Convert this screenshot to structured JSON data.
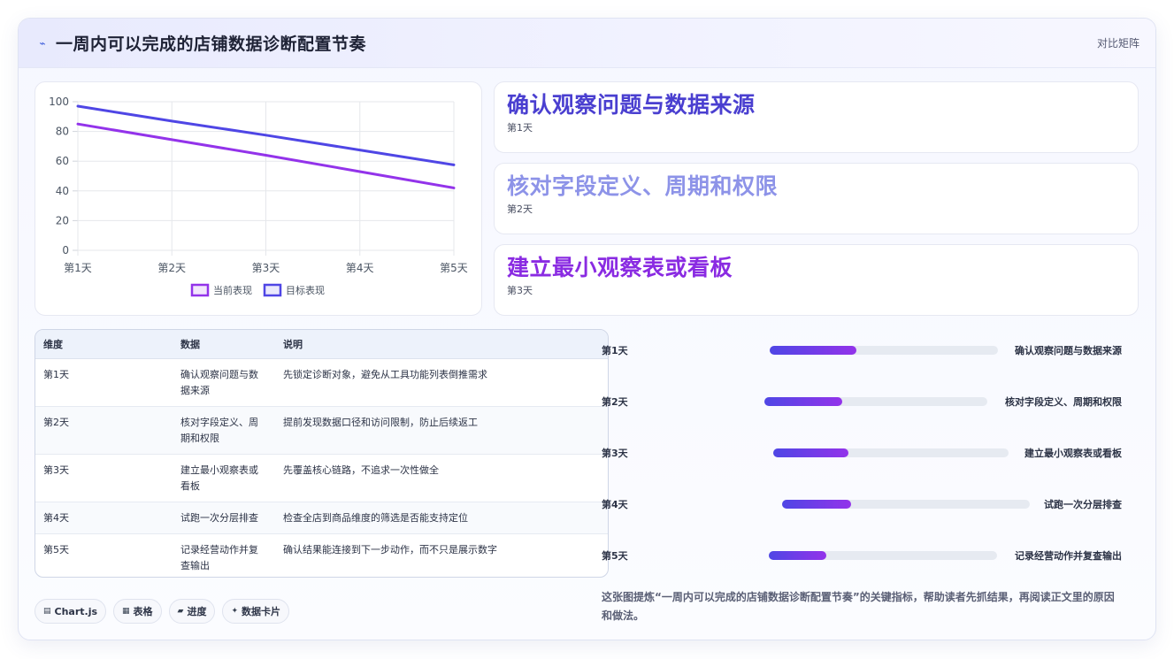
{
  "header": {
    "icon": "pulse-icon",
    "title": "一周内可以完成的店铺数据诊断配置节奏",
    "right_label": "对比矩阵"
  },
  "chart_data": {
    "type": "line",
    "categories": [
      "第1天",
      "第2天",
      "第3天",
      "第4天",
      "第5天"
    ],
    "series": [
      {
        "name": "当前表现",
        "values": [
          85,
          74.5,
          64,
          53,
          42
        ],
        "color": "#9333ea"
      },
      {
        "name": "目标表现",
        "values": [
          97,
          87,
          77.5,
          67.5,
          57.5
        ],
        "color": "#4f46e5"
      }
    ],
    "ylim": [
      0,
      100
    ],
    "yticks": [
      0,
      20,
      40,
      60,
      80,
      100
    ],
    "grid": true,
    "legend": "bottom"
  },
  "stats": [
    {
      "title": "确认观察问题与数据来源",
      "sub": "第1天",
      "color": "#4a3fd0"
    },
    {
      "title": "核对字段定义、周期和权限",
      "sub": "第2天",
      "color": "#8d93e8"
    },
    {
      "title": "建立最小观察表或看板",
      "sub": "第3天",
      "color": "#8a2be2"
    }
  ],
  "table": {
    "headers": [
      "维度",
      "数据",
      "说明"
    ],
    "rows": [
      [
        "第1天",
        "确认观察问题与数据来源",
        "先锁定诊断对象，避免从工具功能列表倒推需求"
      ],
      [
        "第2天",
        "核对字段定义、周期和权限",
        "提前发现数据口径和访问限制，防止后续返工"
      ],
      [
        "第3天",
        "建立最小观察表或看板",
        "先覆盖核心链路，不追求一次性做全"
      ],
      [
        "第4天",
        "试跑一次分层排查",
        "检查全店到商品维度的筛选是否能支持定位"
      ],
      [
        "第5天",
        "记录经营动作并复查输出",
        "确认结果能连接到下一步动作，而不只是展示数字"
      ]
    ]
  },
  "progress": [
    {
      "label": "第1天",
      "text": "确认观察问题与数据来源",
      "value": 0.38
    },
    {
      "label": "第2天",
      "text": "核对字段定义、周期和权限",
      "value": 0.35
    },
    {
      "label": "第3天",
      "text": "建立最小观察表或看板",
      "value": 0.32
    },
    {
      "label": "第4天",
      "text": "试跑一次分层排查",
      "value": 0.28
    },
    {
      "label": "第5天",
      "text": "记录经营动作并复查输出",
      "value": 0.25
    }
  ],
  "note": "这张图提炼“一周内可以完成的店铺数据诊断配置节奏”的关键指标，帮助读者先抓结果，再阅读正文里的原因和做法。",
  "chips": [
    {
      "icon": "chart-icon",
      "glyph": "▤",
      "label": "Chart.js"
    },
    {
      "icon": "table-icon",
      "glyph": "▦",
      "label": "表格"
    },
    {
      "icon": "progress-icon",
      "glyph": "▰",
      "label": "进度"
    },
    {
      "icon": "sparkle-icon",
      "glyph": "✦",
      "label": "数据卡片"
    }
  ]
}
